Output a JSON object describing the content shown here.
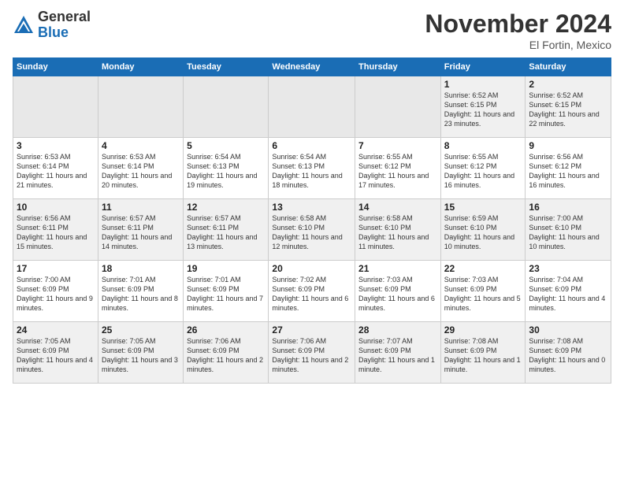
{
  "logo": {
    "general": "General",
    "blue": "Blue"
  },
  "title": "November 2024",
  "location": "El Fortin, Mexico",
  "days_of_week": [
    "Sunday",
    "Monday",
    "Tuesday",
    "Wednesday",
    "Thursday",
    "Friday",
    "Saturday"
  ],
  "weeks": [
    [
      {
        "day": "",
        "info": ""
      },
      {
        "day": "",
        "info": ""
      },
      {
        "day": "",
        "info": ""
      },
      {
        "day": "",
        "info": ""
      },
      {
        "day": "",
        "info": ""
      },
      {
        "day": "1",
        "info": "Sunrise: 6:52 AM\nSunset: 6:15 PM\nDaylight: 11 hours and 23 minutes."
      },
      {
        "day": "2",
        "info": "Sunrise: 6:52 AM\nSunset: 6:15 PM\nDaylight: 11 hours and 22 minutes."
      }
    ],
    [
      {
        "day": "3",
        "info": "Sunrise: 6:53 AM\nSunset: 6:14 PM\nDaylight: 11 hours and 21 minutes."
      },
      {
        "day": "4",
        "info": "Sunrise: 6:53 AM\nSunset: 6:14 PM\nDaylight: 11 hours and 20 minutes."
      },
      {
        "day": "5",
        "info": "Sunrise: 6:54 AM\nSunset: 6:13 PM\nDaylight: 11 hours and 19 minutes."
      },
      {
        "day": "6",
        "info": "Sunrise: 6:54 AM\nSunset: 6:13 PM\nDaylight: 11 hours and 18 minutes."
      },
      {
        "day": "7",
        "info": "Sunrise: 6:55 AM\nSunset: 6:12 PM\nDaylight: 11 hours and 17 minutes."
      },
      {
        "day": "8",
        "info": "Sunrise: 6:55 AM\nSunset: 6:12 PM\nDaylight: 11 hours and 16 minutes."
      },
      {
        "day": "9",
        "info": "Sunrise: 6:56 AM\nSunset: 6:12 PM\nDaylight: 11 hours and 16 minutes."
      }
    ],
    [
      {
        "day": "10",
        "info": "Sunrise: 6:56 AM\nSunset: 6:11 PM\nDaylight: 11 hours and 15 minutes."
      },
      {
        "day": "11",
        "info": "Sunrise: 6:57 AM\nSunset: 6:11 PM\nDaylight: 11 hours and 14 minutes."
      },
      {
        "day": "12",
        "info": "Sunrise: 6:57 AM\nSunset: 6:11 PM\nDaylight: 11 hours and 13 minutes."
      },
      {
        "day": "13",
        "info": "Sunrise: 6:58 AM\nSunset: 6:10 PM\nDaylight: 11 hours and 12 minutes."
      },
      {
        "day": "14",
        "info": "Sunrise: 6:58 AM\nSunset: 6:10 PM\nDaylight: 11 hours and 11 minutes."
      },
      {
        "day": "15",
        "info": "Sunrise: 6:59 AM\nSunset: 6:10 PM\nDaylight: 11 hours and 10 minutes."
      },
      {
        "day": "16",
        "info": "Sunrise: 7:00 AM\nSunset: 6:10 PM\nDaylight: 11 hours and 10 minutes."
      }
    ],
    [
      {
        "day": "17",
        "info": "Sunrise: 7:00 AM\nSunset: 6:09 PM\nDaylight: 11 hours and 9 minutes."
      },
      {
        "day": "18",
        "info": "Sunrise: 7:01 AM\nSunset: 6:09 PM\nDaylight: 11 hours and 8 minutes."
      },
      {
        "day": "19",
        "info": "Sunrise: 7:01 AM\nSunset: 6:09 PM\nDaylight: 11 hours and 7 minutes."
      },
      {
        "day": "20",
        "info": "Sunrise: 7:02 AM\nSunset: 6:09 PM\nDaylight: 11 hours and 6 minutes."
      },
      {
        "day": "21",
        "info": "Sunrise: 7:03 AM\nSunset: 6:09 PM\nDaylight: 11 hours and 6 minutes."
      },
      {
        "day": "22",
        "info": "Sunrise: 7:03 AM\nSunset: 6:09 PM\nDaylight: 11 hours and 5 minutes."
      },
      {
        "day": "23",
        "info": "Sunrise: 7:04 AM\nSunset: 6:09 PM\nDaylight: 11 hours and 4 minutes."
      }
    ],
    [
      {
        "day": "24",
        "info": "Sunrise: 7:05 AM\nSunset: 6:09 PM\nDaylight: 11 hours and 4 minutes."
      },
      {
        "day": "25",
        "info": "Sunrise: 7:05 AM\nSunset: 6:09 PM\nDaylight: 11 hours and 3 minutes."
      },
      {
        "day": "26",
        "info": "Sunrise: 7:06 AM\nSunset: 6:09 PM\nDaylight: 11 hours and 2 minutes."
      },
      {
        "day": "27",
        "info": "Sunrise: 7:06 AM\nSunset: 6:09 PM\nDaylight: 11 hours and 2 minutes."
      },
      {
        "day": "28",
        "info": "Sunrise: 7:07 AM\nSunset: 6:09 PM\nDaylight: 11 hours and 1 minute."
      },
      {
        "day": "29",
        "info": "Sunrise: 7:08 AM\nSunset: 6:09 PM\nDaylight: 11 hours and 1 minute."
      },
      {
        "day": "30",
        "info": "Sunrise: 7:08 AM\nSunset: 6:09 PM\nDaylight: 11 hours and 0 minutes."
      }
    ]
  ]
}
